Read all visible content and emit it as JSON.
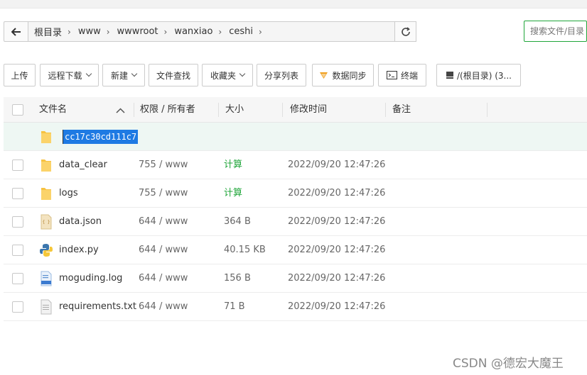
{
  "breadcrumb": [
    "根目录",
    "www",
    "wwwroot",
    "wanxiao",
    "ceshi"
  ],
  "search": {
    "placeholder": "搜索文件/目录"
  },
  "toolbar": {
    "upload": "上传",
    "remote_download": "远程下载",
    "new": "新建",
    "file_search": "文件查找",
    "favorites": "收藏夹",
    "share_list": "分享列表",
    "data_sync": "数据同步",
    "terminal": "终端",
    "disk": "/(根目录) (3..."
  },
  "table": {
    "headers": {
      "name": "文件名",
      "perm": "权限 / 所有者",
      "size": "大小",
      "mtime": "修改时间",
      "note": "备注"
    },
    "rename_value": "cc17c30cd111c7",
    "rows": [
      {
        "name": "data_clear",
        "perm": "755 / www",
        "size": "计算",
        "mtime": "2022/09/20 12:47:26",
        "icon": "folder-icon"
      },
      {
        "name": "logs",
        "perm": "755 / www",
        "size": "计算",
        "mtime": "2022/09/20 12:47:26",
        "icon": "folder-icon"
      },
      {
        "name": "data.json",
        "perm": "644 / www",
        "size": "364 B",
        "mtime": "2022/09/20 12:47:26",
        "icon": "json-file-icon"
      },
      {
        "name": "index.py",
        "perm": "644 / www",
        "size": "40.15 KB",
        "mtime": "2022/09/20 12:47:26",
        "icon": "python-file-icon"
      },
      {
        "name": "moguding.log",
        "perm": "644 / www",
        "size": "156 B",
        "mtime": "2022/09/20 12:47:26",
        "icon": "log-file-icon"
      },
      {
        "name": "requirements.txt",
        "perm": "644 / www",
        "size": "71 B",
        "mtime": "2022/09/20 12:47:26",
        "icon": "text-file-icon"
      }
    ]
  },
  "watermark": "CSDN @德宏大魔王",
  "colors": {
    "accent": "#20a53a",
    "selection": "#1e7ae3",
    "folder": "#f7c241"
  }
}
